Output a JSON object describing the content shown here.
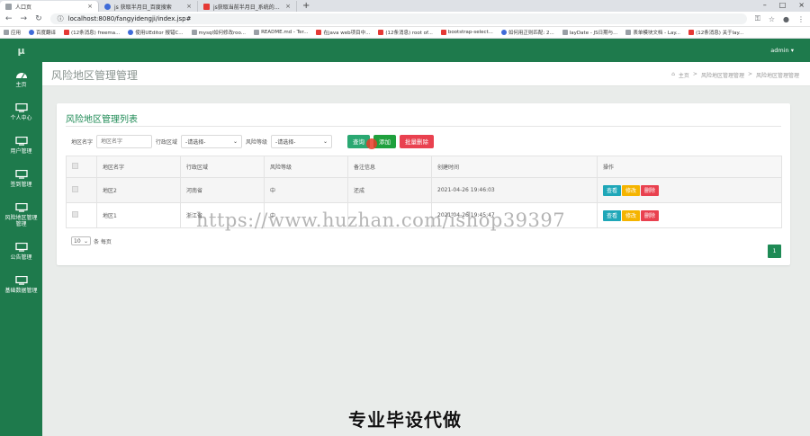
{
  "browser": {
    "tabs": [
      {
        "title": "人口页",
        "favicon": "page",
        "active": true
      },
      {
        "title": "js 获取半月日_百度搜索",
        "favicon": "blue",
        "active": false
      },
      {
        "title": "js获取当前半月日_系统的个人的",
        "favicon": "red",
        "active": false
      }
    ],
    "url": "localhost:8080/fangyidengji/index.jsp#",
    "bookmarks": [
      {
        "label": "应用",
        "favicon": "page"
      },
      {
        "label": "百度翻译",
        "favicon": "blue"
      },
      {
        "label": "(12条消息) freema...",
        "favicon": "red"
      },
      {
        "label": "使用UEditor 报错C...",
        "favicon": "blue"
      },
      {
        "label": "mysql如何修改roo...",
        "favicon": "page"
      },
      {
        "label": "README.md - Ter...",
        "favicon": "page"
      },
      {
        "label": "在java web项目中...",
        "favicon": "red"
      },
      {
        "label": "(12条消息) root of...",
        "favicon": "red"
      },
      {
        "label": "bootstrap-select...",
        "favicon": "red"
      },
      {
        "label": "如何用正则匹配: 2...",
        "favicon": "blue"
      },
      {
        "label": "layDate - JS日期与...",
        "favicon": "page"
      },
      {
        "label": "表单模块文档 - Lay...",
        "favicon": "page"
      },
      {
        "label": "(12条消息) 关于lay...",
        "favicon": "red"
      }
    ]
  },
  "app": {
    "logo": "μ",
    "admin_label": "admin ▾",
    "sidebar": [
      {
        "label": "主页",
        "icon": "dashboard-icon"
      },
      {
        "label": "个人中心",
        "icon": "monitor-icon"
      },
      {
        "label": "用户管理",
        "icon": "monitor-icon"
      },
      {
        "label": "签到管理",
        "icon": "monitor-icon"
      },
      {
        "label": "风险地区管理管理",
        "icon": "monitor-icon"
      },
      {
        "label": "公告管理",
        "icon": "monitor-icon"
      },
      {
        "label": "基础数据管理",
        "icon": "monitor-icon"
      }
    ],
    "page_title": "风险地区管理管理",
    "breadcrumb": {
      "home": "主页",
      "level1": "风险地区管理管理",
      "level2": "风险地区管理管理",
      "sep": ">"
    },
    "card_title": "风险地区管理列表",
    "search": {
      "name_label": "地区名字",
      "name_placeholder": "地区名字",
      "region_label": "行政区域",
      "region_value": "-请选择-",
      "level_label": "风险等级",
      "level_value": "-请选择-",
      "query_btn": "查询",
      "add_btn": "添加",
      "batch_delete_btn": "批量删除"
    },
    "table": {
      "headers": [
        "地区名字",
        "行政区域",
        "风险等级",
        "备注信息",
        "创建时间",
        "操作"
      ],
      "rows": [
        {
          "name": "地区2",
          "region": "河南省",
          "level": "中",
          "remark": "还成",
          "created": "2021-04-26 19:46:03"
        },
        {
          "name": "地区1",
          "region": "浙江省",
          "level": "中",
          "remark": "",
          "created": "2021-04-26 19:45:47"
        }
      ],
      "op_labels": {
        "view": "查看",
        "edit": "修改",
        "delete": "删除"
      }
    },
    "pagination": {
      "page_size": "10",
      "page_size_suffix": "条 每页",
      "current_page": "1"
    }
  },
  "overlay": {
    "bottom_text": "专业毕设代做",
    "watermark": "https://www.huzhan.com/ishop39397"
  },
  "colors": {
    "primary": "#1e7a4c",
    "accent": "#1e8a55",
    "danger": "#e9414f",
    "warning": "#f5b400",
    "info": "#1fa7b8"
  }
}
